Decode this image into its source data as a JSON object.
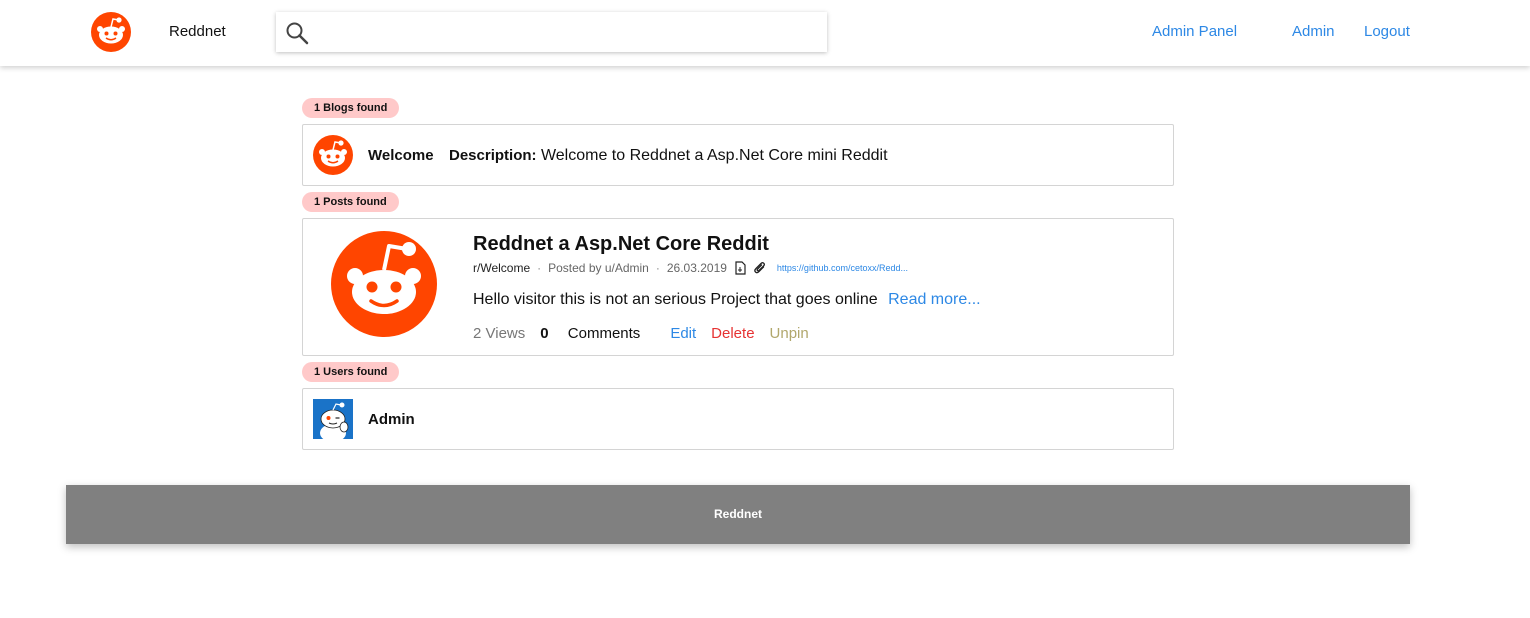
{
  "navbar": {
    "brand_name": "Reddnet",
    "search_placeholder": "",
    "links": {
      "admin_panel": "Admin Panel",
      "admin": "Admin",
      "logout": "Logout"
    }
  },
  "blogs": {
    "badge": "1 Blogs found",
    "items": [
      {
        "name": "Welcome",
        "description_label": "Description:",
        "description": "Welcome to Reddnet a Asp.Net Core mini Reddit"
      }
    ]
  },
  "posts": {
    "badge": "1 Posts found",
    "items": [
      {
        "title": "Reddnet a Asp.Net Core Reddit",
        "subreddit": "r/Welcome",
        "posted_by": "Posted by u/Admin",
        "date": "26.03.2019",
        "url": "https://github.com/cetoxx/Redd...",
        "body": "Hello visitor this is not an serious Project that goes online",
        "read_more": "Read more...",
        "views": "2 Views",
        "comments_count": "0",
        "comments_label": "Comments",
        "edit": "Edit",
        "delete": "Delete",
        "unpin": "Unpin"
      }
    ]
  },
  "users": {
    "badge": "1 Users found",
    "items": [
      {
        "name": "Admin"
      }
    ]
  },
  "footer": {
    "text": "Reddnet"
  },
  "colors": {
    "accent": "#2d88e5",
    "brand": "#ff4500",
    "badge": "#ffc9c9",
    "delete": "#e63232",
    "unpin": "#b1a76c",
    "footer": "#808080"
  }
}
